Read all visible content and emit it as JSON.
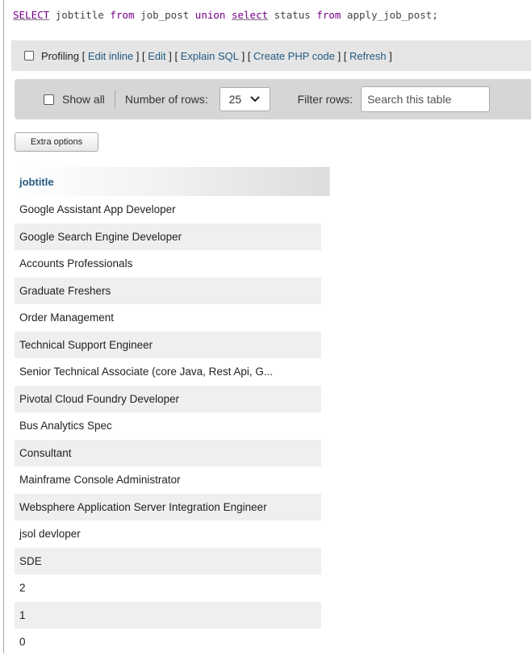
{
  "sql_query": {
    "select_kw": "SELECT",
    "part1": " jobtitle ",
    "from_kw1": "from",
    "part2": " job_post ",
    "union_kw": "union",
    "space": " ",
    "select_kw2": "select",
    "part3": " status ",
    "from_kw2": "from",
    "part4": " apply_job_post;"
  },
  "profiling_bar": {
    "label": "Profiling",
    "open1": " [ ",
    "edit_inline": "Edit inline",
    "sep1": " ] [ ",
    "edit": "Edit",
    "sep2": " ] [ ",
    "explain_sql": "Explain SQL",
    "sep3": " ] [ ",
    "create_php": "Create PHP code",
    "sep4": " ] [ ",
    "refresh": "Refresh",
    "close": " ]"
  },
  "navigation": {
    "show_all": "Show all",
    "number_of_rows_label": "Number of rows:",
    "rows_value": "25",
    "filter_label": "Filter rows:",
    "filter_placeholder": "Search this table"
  },
  "extra_options": "Extra options",
  "table": {
    "column": "jobtitle",
    "rows": [
      "Google Assistant App Developer",
      "Google Search Engine Developer",
      "Accounts Professionals",
      "Graduate Freshers",
      "Order Management",
      "Technical Support Engineer",
      "Senior Technical Associate (core Java, Rest Api, G...",
      "Pivotal Cloud Foundry Developer",
      "Bus Analytics Spec",
      "Consultant",
      "Mainframe Console Administrator",
      "Websphere Application Server Integration Engineer",
      "jsol devloper",
      "SDE",
      "2",
      "1",
      "0"
    ]
  },
  "colors": {
    "link": "#235a81",
    "keyword": "#770088",
    "toolbar_bg": "#e5e5e5",
    "nav_bg": "#d6d6d6",
    "row_even": "#efefef"
  }
}
